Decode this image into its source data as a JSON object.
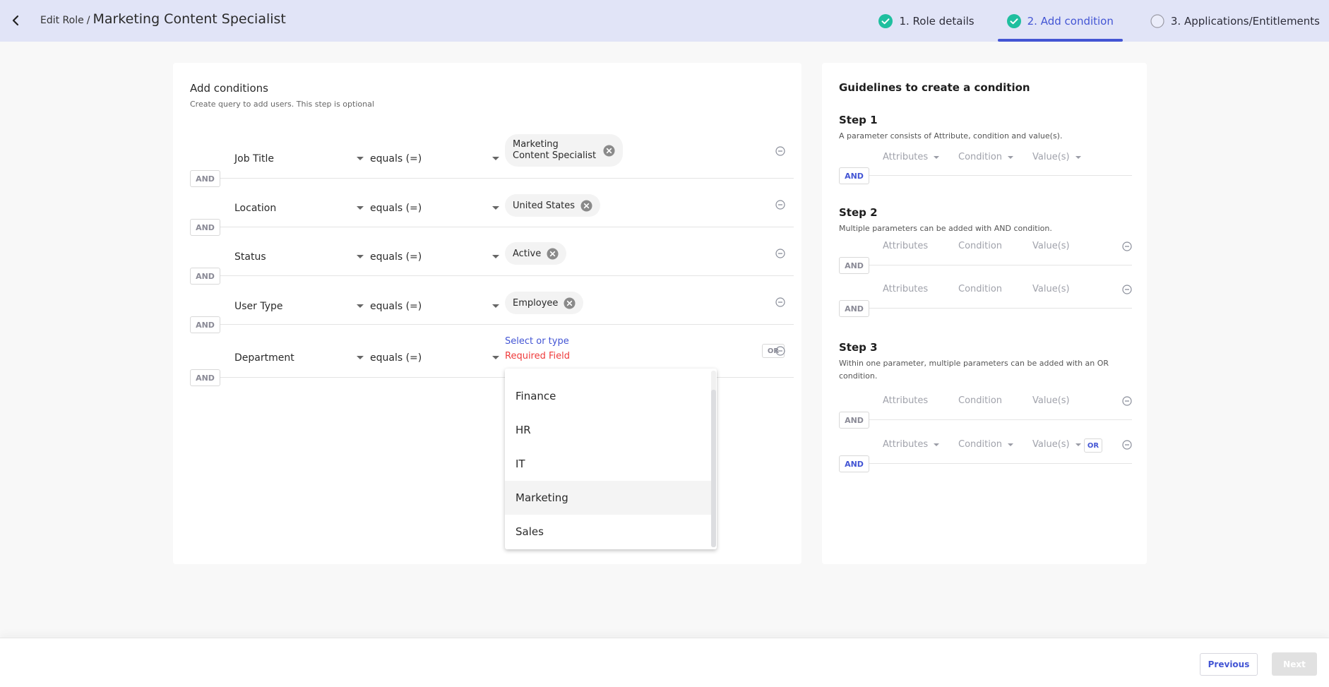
{
  "header": {
    "breadcrumb_parent": "Edit Role",
    "breadcrumb_separator": "/",
    "title": "Marketing Content Specialist",
    "steps": [
      {
        "label": "1. Role details",
        "status": "complete"
      },
      {
        "label": "2. Add condition",
        "status": "complete",
        "active": true
      },
      {
        "label": "3. Applications/Entitlements",
        "status": "pending"
      }
    ]
  },
  "conditions": {
    "title": "Add conditions",
    "subtitle": "Create query to add users. This step is optional",
    "rows": [
      {
        "attribute": "Job Title",
        "condition": "equals (=)",
        "values": [
          "Marketing Content Specialist"
        ],
        "connector": "AND"
      },
      {
        "attribute": "Location",
        "condition": "equals (=)",
        "values": [
          "United States"
        ],
        "connector": "AND"
      },
      {
        "attribute": "Status",
        "condition": "equals (=)",
        "values": [
          "Active"
        ],
        "connector": "AND"
      },
      {
        "attribute": "User Type",
        "condition": "equals (=)",
        "values": [
          "Employee"
        ],
        "connector": "AND"
      },
      {
        "attribute": "Department",
        "condition": "equals (=)",
        "values": [],
        "placeholder": "Select or type",
        "error": "Required Field",
        "or_label": "OR",
        "connector": "AND"
      }
    ],
    "dropdown_options": [
      "Finance",
      "HR",
      "IT",
      "Marketing",
      "Sales"
    ],
    "dropdown_hovered": "Marketing"
  },
  "guidelines": {
    "title": "Guidelines to create a condition",
    "attr_label": "Attributes",
    "cond_label": "Condition",
    "value_label": "Value(s)",
    "and_label": "AND",
    "or_label": "OR",
    "steps": [
      {
        "title": "Step 1",
        "description": "A parameter consists of Attribute, condition and value(s)."
      },
      {
        "title": "Step 2",
        "description": "Multiple parameters can be added with AND condition."
      },
      {
        "title": "Step 3",
        "description": "Within one parameter, multiple parameters can be added with an OR condition."
      }
    ]
  },
  "footer": {
    "previous_label": "Previous",
    "next_label": "Next",
    "next_disabled": true
  },
  "colors": {
    "accent": "#4355d4",
    "header_bg": "#e1e4f7",
    "success": "#1fbf9f",
    "error": "#ef3b3b"
  }
}
